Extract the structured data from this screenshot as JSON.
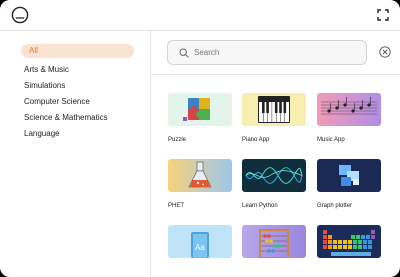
{
  "search": {
    "placeholder": "Search"
  },
  "categories": [
    {
      "label": "All",
      "active": true
    },
    {
      "label": "Arts & Music"
    },
    {
      "label": "Simulations"
    },
    {
      "label": "Computer Science"
    },
    {
      "label": "Science & Mathematics"
    },
    {
      "label": "Language"
    }
  ],
  "apps": [
    {
      "label": "Puzzle",
      "icon": "puzzle-pieces"
    },
    {
      "label": "Piano App",
      "icon": "piano-keys"
    },
    {
      "label": "Music App",
      "icon": "music-notes"
    },
    {
      "label": "PHET",
      "icon": "flask"
    },
    {
      "label": "Learn Python",
      "icon": "waveform"
    },
    {
      "label": "Graph plotter",
      "icon": "cubes"
    },
    {
      "label": "",
      "icon": "dictionary-book"
    },
    {
      "label": "",
      "icon": "abacus"
    },
    {
      "label": "",
      "icon": "periodic-table"
    }
  ],
  "colors": {
    "accent": "#e47b3a",
    "active_bg": "#fbe3d3"
  }
}
